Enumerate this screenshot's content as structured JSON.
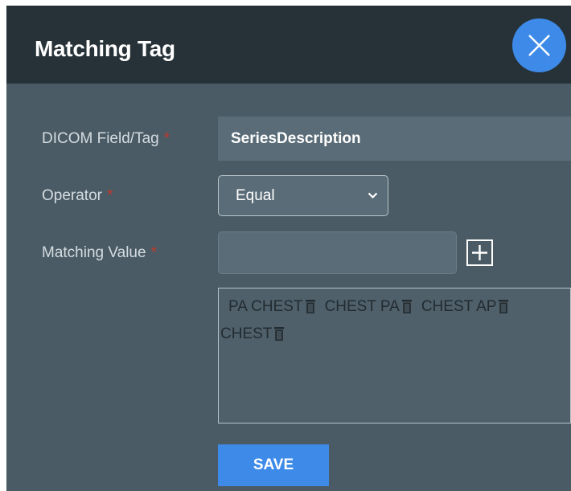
{
  "dialog": {
    "title": "Matching Tag",
    "close_icon": "close-x-icon"
  },
  "form": {
    "required_marker": "*",
    "dicom_field": {
      "label": "DICOM Field/Tag",
      "value": "SeriesDescription"
    },
    "operator": {
      "label": "Operator",
      "selected": "Equal",
      "icon": "chevron-down-icon"
    },
    "matching_value": {
      "label": "Matching Value",
      "value": "",
      "add_icon": "plus-icon"
    },
    "tags": [
      {
        "text": "PA CHEST"
      },
      {
        "text": "CHEST PA"
      },
      {
        "text": "CHEST AP"
      },
      {
        "text": "CHEST"
      }
    ],
    "tag_delete_icon": "trash-icon",
    "save_label": "SAVE"
  },
  "colors": {
    "header_bg": "#263238",
    "body_bg": "#4b5b65",
    "input_bg": "#5a6c77",
    "accent": "#3d8ae8",
    "required": "#c0392b"
  }
}
